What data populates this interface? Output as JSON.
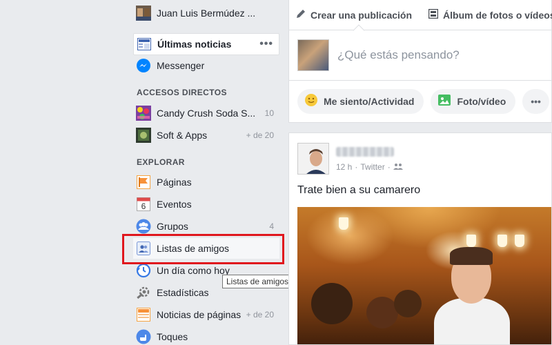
{
  "sidebar": {
    "profile_name": "Juan Luis Bermúdez ...",
    "news_feed_label": "Últimas noticias",
    "news_feed_more": "•••",
    "messenger_label": "Messenger",
    "shortcuts_heading": "ACCESOS DIRECTOS",
    "shortcuts": [
      {
        "label": "Candy Crush Soda S...",
        "count": "10",
        "icon": "candy-crush-app-icon"
      },
      {
        "label": "Soft & Apps",
        "count": "+ de 20",
        "icon": "soft-apps-icon"
      }
    ],
    "explore_heading": "EXPLORAR",
    "explore": [
      {
        "label": "Páginas",
        "count": "",
        "icon": "flag-icon"
      },
      {
        "label": "Eventos",
        "count": "",
        "icon": "calendar-icon",
        "calendar_day": "6"
      },
      {
        "label": "Grupos",
        "count": "4",
        "icon": "groups-icon"
      },
      {
        "label": "Listas de amigos",
        "count": "",
        "icon": "friend-lists-icon"
      },
      {
        "label": "Un día como hoy",
        "count": "",
        "icon": "clock-icon"
      },
      {
        "label": "Estadísticas",
        "count": "",
        "icon": "stats-icon"
      },
      {
        "label": "Noticias de páginas",
        "count": "+ de 20",
        "icon": "page-news-icon"
      },
      {
        "label": "Toques",
        "count": "",
        "icon": "poke-icon"
      }
    ],
    "tooltip": "Listas de amigos"
  },
  "composer": {
    "tab_create_post": "Crear una publicación",
    "tab_album": "Álbum de fotos o vídeos",
    "placeholder": "¿Qué estás pensando?",
    "action_feeling": "Me siento/Actividad",
    "action_photo": "Foto/vídeo",
    "action_more": "•••"
  },
  "post": {
    "time": "12 h",
    "source": "Twitter",
    "separator": "·",
    "text": "Trate bien a su camarero"
  },
  "colors": {
    "facebook_blue": "#4267b2",
    "highlight_red": "#e0161d",
    "page_background": "#e9ebee"
  }
}
